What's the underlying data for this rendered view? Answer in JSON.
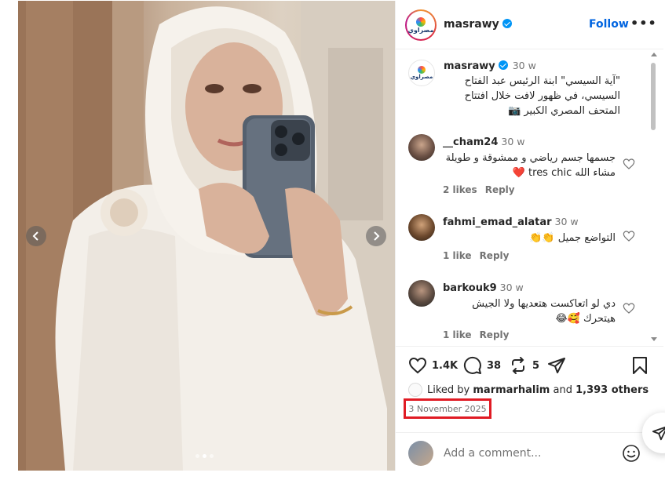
{
  "post": {
    "username": "masrawy",
    "follow_label": "Follow",
    "more_label": "•••",
    "brand_logo_text": "مصراوي"
  },
  "caption": {
    "username": "masrawy",
    "time": "30 w",
    "text": "\"آية السيسي\" ابنة الرئيس عبد الفتاح السيسي، في ظهور لافت خلال افتتاح المتحف المصري الكبير 📷"
  },
  "comments": [
    {
      "username": "__cham24",
      "time": "30 w",
      "text": "جسمها جسم رياضي و ممشوقة و طويلة مشاء الله tres chic ❤️",
      "likes": "2 likes",
      "reply": "Reply"
    },
    {
      "username": "fahmi_emad_alatar",
      "time": "30 w",
      "text": "التواضع جميل 👏👏",
      "likes": "1 like",
      "reply": "Reply"
    },
    {
      "username": "barkouk9",
      "time": "30 w",
      "text": "دي لو اتعاكست هتعديها ولا الجيش هيتحرك 🥰😂",
      "likes": "1 like",
      "reply": "Reply"
    }
  ],
  "actions": {
    "like_count": "1.4K",
    "comment_count": "38",
    "repost_count": "5"
  },
  "liked_by": {
    "prefix": "Liked by",
    "user": "marmarhalim",
    "and": "and",
    "others": "1,393 others"
  },
  "date": "3 November 2025",
  "add_comment": {
    "placeholder": "Add a comment..."
  },
  "carousel": {
    "slide_count": 3,
    "active_slide": 2
  },
  "colors": {
    "verified": "#0095f6",
    "follow": "#0064e0",
    "highlight_box": "#e01b24",
    "like_heart": "#262626"
  }
}
